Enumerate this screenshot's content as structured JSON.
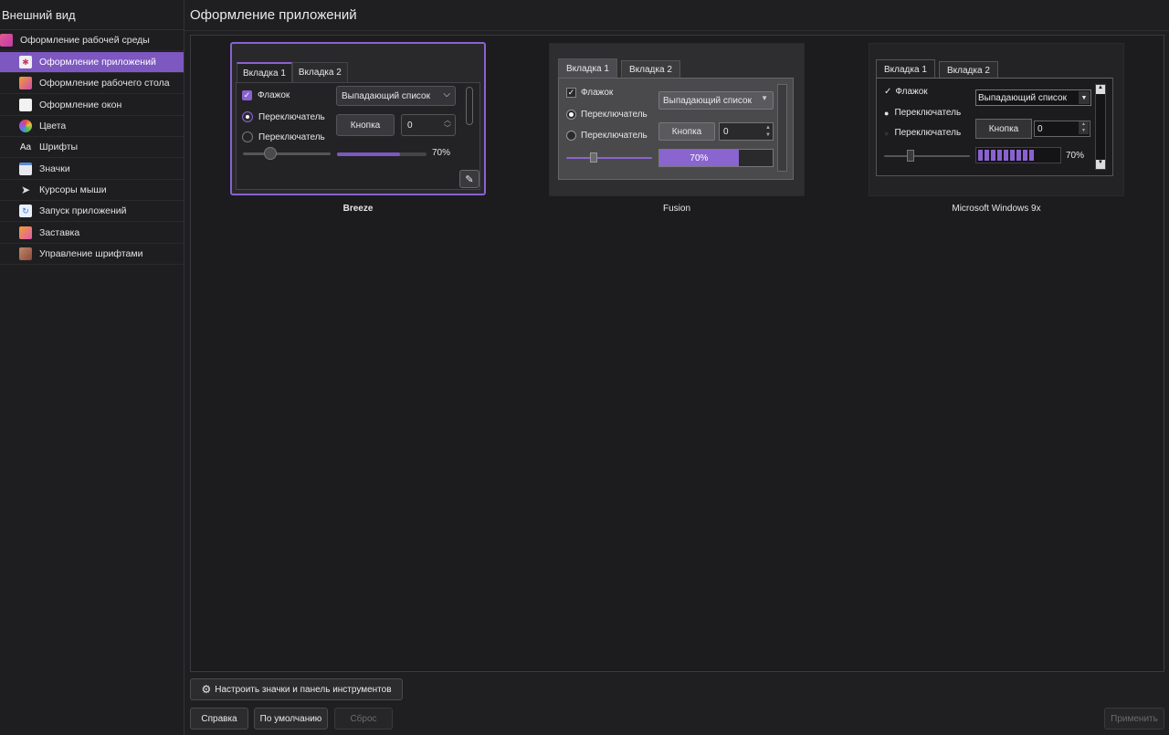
{
  "sidebar": {
    "title": "Внешний вид",
    "items": [
      {
        "label": "Оформление рабочей среды",
        "icon": "workspace-icon",
        "color": "#c04a8c"
      },
      {
        "label": "Оформление приложений",
        "icon": "app-style-icon",
        "color": "#ffffff"
      },
      {
        "label": "Оформление рабочего стола",
        "icon": "plasma-icon",
        "color": "#e0a030"
      },
      {
        "label": "Оформление окон",
        "icon": "window-decoration-icon",
        "color": "#ffffff"
      },
      {
        "label": "Цвета",
        "icon": "colors-icon",
        "color": "#e04a4a"
      },
      {
        "label": "Шрифты",
        "icon": "fonts-icon",
        "color": "#ffffff"
      },
      {
        "label": "Значки",
        "icon": "icons-icon",
        "color": "#5a8ad8"
      },
      {
        "label": "Курсоры мыши",
        "icon": "cursor-icon",
        "color": "#dddddd"
      },
      {
        "label": "Запуск приложений",
        "icon": "launch-feedback-icon",
        "color": "#3c7ad8"
      },
      {
        "label": "Заставка",
        "icon": "splash-icon",
        "color": "#e05ab0"
      },
      {
        "label": "Управление шрифтами",
        "icon": "font-manager-icon",
        "color": "#a06a4a"
      }
    ]
  },
  "header": {
    "title": "Оформление приложений"
  },
  "preview": {
    "tab1": "Вкладка 1",
    "tab2": "Вкладка 2",
    "checkbox": "Флажок",
    "radio": "Переключатель",
    "combo": "Выпадающий список",
    "button": "Кнопка",
    "spin_value": "0",
    "progress_text": "70%",
    "progress": 0.7
  },
  "themes": [
    {
      "name": "Breeze",
      "selected": true
    },
    {
      "name": "Fusion",
      "selected": false
    },
    {
      "name": "Microsoft Windows 9x",
      "selected": false
    }
  ],
  "buttons": {
    "configure_icons": "Настроить значки и панель инструментов",
    "help": "Справка",
    "defaults": "По умолчанию",
    "reset": "Сброс",
    "apply": "Применить"
  },
  "colors": {
    "accent": "#7d58c0",
    "background": "#1f1f21"
  }
}
